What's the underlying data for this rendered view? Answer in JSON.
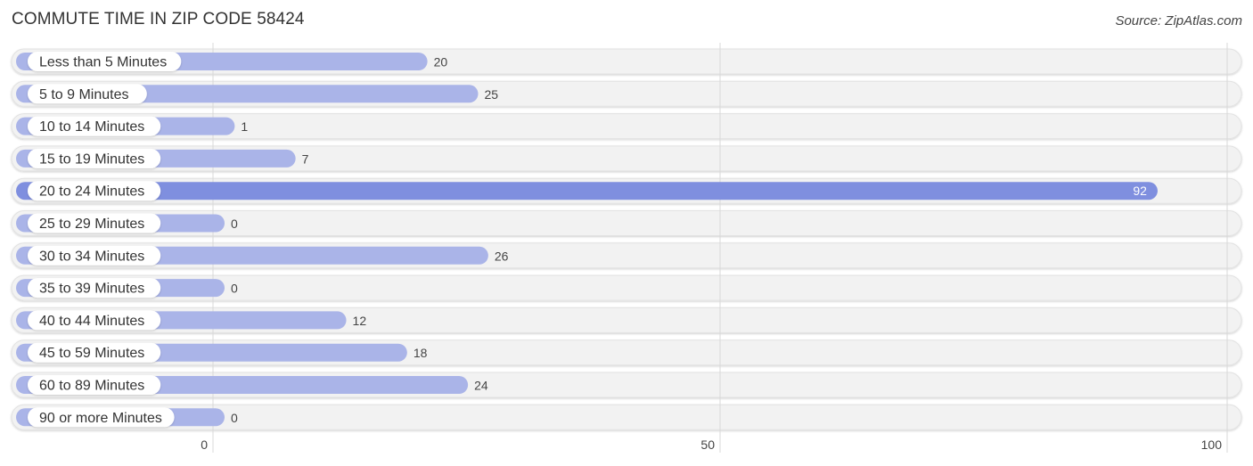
{
  "header": {
    "title": "COMMUTE TIME IN ZIP CODE 58424",
    "source": "Source: ZipAtlas.com"
  },
  "colors": {
    "bar": "#aab4e8",
    "bar_highlight": "#7f8fdf",
    "track": "#f2f2f2",
    "grid": "#d8d8d8"
  },
  "chart_data": {
    "type": "bar",
    "orientation": "horizontal",
    "title": "COMMUTE TIME IN ZIP CODE 58424",
    "xlabel": "",
    "ylabel": "",
    "xlim": [
      0,
      100
    ],
    "grid": true,
    "x_ticks": [
      0,
      50,
      100
    ],
    "x_tick_labels": [
      "0",
      "50",
      "100"
    ],
    "categories": [
      "Less than 5 Minutes",
      "5 to 9 Minutes",
      "10 to 14 Minutes",
      "15 to 19 Minutes",
      "20 to 24 Minutes",
      "25 to 29 Minutes",
      "30 to 34 Minutes",
      "35 to 39 Minutes",
      "40 to 44 Minutes",
      "45 to 59 Minutes",
      "60 to 89 Minutes",
      "90 or more Minutes"
    ],
    "values": [
      20,
      25,
      1,
      7,
      92,
      0,
      26,
      0,
      12,
      18,
      24,
      0
    ],
    "highlight_index": 4
  }
}
